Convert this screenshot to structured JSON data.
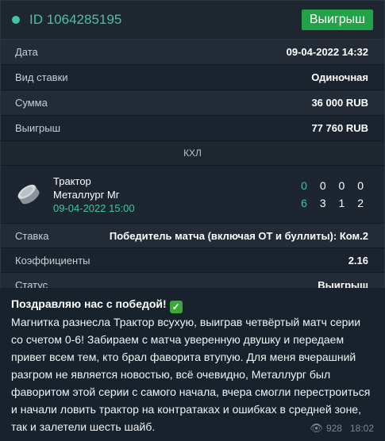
{
  "ticket": {
    "id_label": "ID 1064285195",
    "status_badge": "Выигрыш"
  },
  "details": [
    {
      "label": "Дата",
      "value": "09-04-2022 14:32"
    },
    {
      "label": "Вид ставки",
      "value": "Одиночная"
    },
    {
      "label": "Сумма",
      "value": "36 000 RUB"
    },
    {
      "label": "Выигрыш",
      "value": "77 760 RUB"
    }
  ],
  "league": "КХЛ",
  "match": {
    "team1": "Трактор",
    "team2": "Металлург Мг",
    "datetime": "09-04-2022 15:00",
    "score1": [
      "0",
      "0",
      "0",
      "0"
    ],
    "score2": [
      "6",
      "3",
      "1",
      "2"
    ]
  },
  "bet": [
    {
      "label": "Ставка",
      "value": "Победитель матча (включая ОТ и буллиты): Ком.2"
    },
    {
      "label": "Коэффициенты",
      "value": "2.16"
    },
    {
      "label": "Статус",
      "value": "Выигрыш"
    }
  ],
  "post": {
    "title": "Поздравляю нас с победой!",
    "check_icon": "✓",
    "body": "Магнитка разнесла Трактор всухую, выиграв четвёртый матч серии со счетом 0-6! Забираем с матча уверенную двушку и передаем привет всем тем, кто брал фаворита втупую. Для меня вчерашний разгром не является новостью, всё очевидно, Металлург был фаворитом этой серии с самого начала, вчера смогли перестроиться и начали ловить трактор на контратаках и ошибках в средней зоне, так и залетели шесть шайб.",
    "views": "928",
    "time": "18:02"
  },
  "colors": {
    "accent": "#45c3a6",
    "win_badge": "#22a34a"
  }
}
